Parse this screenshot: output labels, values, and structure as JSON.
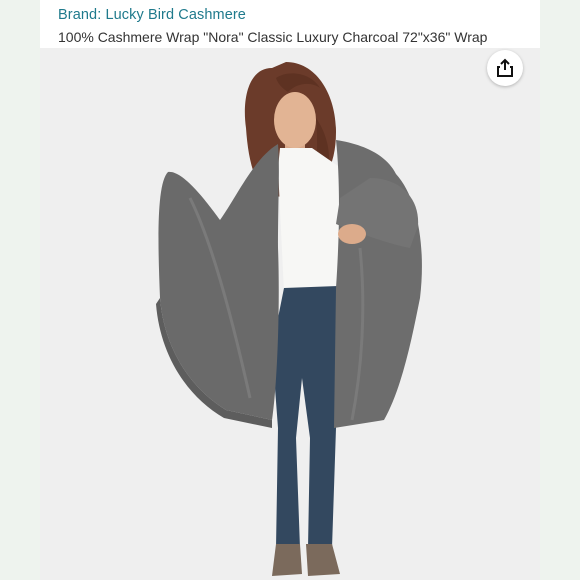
{
  "product": {
    "brand_label": "Brand: Lucky Bird Cashmere",
    "title": "100% Cashmere Wrap \"Nora\" Classic Luxury Charcoal 72\"x36\" Wrap"
  },
  "image": {
    "subject": "model-wearing-charcoal-cashmere-wrap"
  },
  "share": {
    "icon": "share-icon"
  },
  "colors": {
    "brand_link": "#1f7a8c",
    "wrap": "#707070",
    "background": "#efefef"
  }
}
